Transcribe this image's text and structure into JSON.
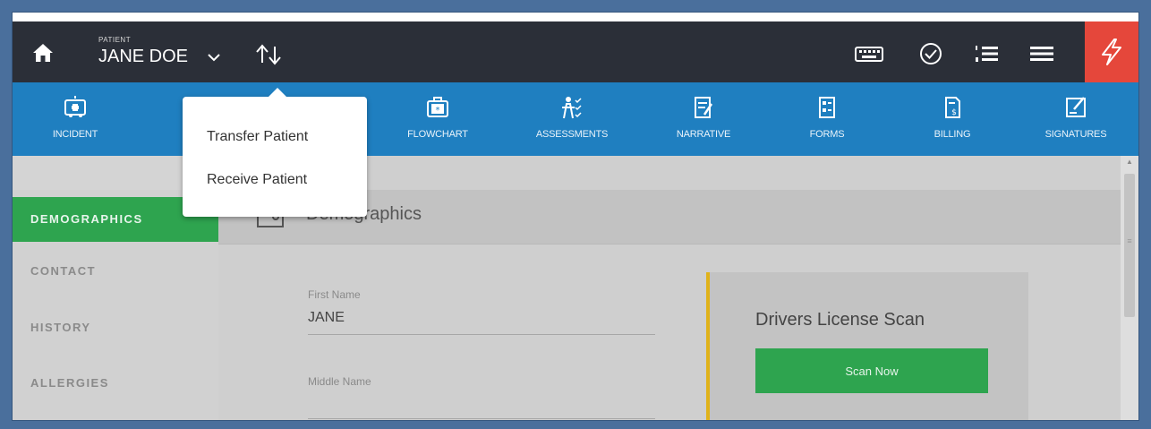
{
  "header": {
    "patient_label": "PATIENT",
    "patient_name": "JANE DOE"
  },
  "icons": {
    "home": "home-icon",
    "chevron": "chevron-down-icon",
    "transfer": "transfer-arrows-icon",
    "keyboard": "keyboard-icon",
    "check": "check-circle-icon",
    "list": "numbered-list-icon",
    "menu": "hamburger-menu-icon",
    "alert": "lightning-icon"
  },
  "colors": {
    "topbar": "#2b2f38",
    "navbar": "#1f7fc0",
    "active_green": "#2ea44f",
    "alert_red": "#e5473b",
    "accent_yellow": "#e0b21a"
  },
  "nav": {
    "items": [
      {
        "label": "INCIDENT",
        "icon": "ambulance-icon"
      },
      {
        "label": "",
        "icon": "patient-icon"
      },
      {
        "label": "",
        "icon": "vitals-icon"
      },
      {
        "label": "FLOWCHART",
        "icon": "medkit-icon"
      },
      {
        "label": "ASSESSMENTS",
        "icon": "assessment-icon"
      },
      {
        "label": "NARRATIVE",
        "icon": "narrative-icon"
      },
      {
        "label": "FORMS",
        "icon": "forms-icon"
      },
      {
        "label": "BILLING",
        "icon": "billing-icon"
      },
      {
        "label": "SIGNATURES",
        "icon": "signature-icon"
      }
    ]
  },
  "popup": {
    "transfer_label": "Transfer Patient",
    "receive_label": "Receive Patient"
  },
  "sidebar": {
    "items": [
      {
        "label": "DEMOGRAPHICS",
        "active": true
      },
      {
        "label": "CONTACT",
        "active": false
      },
      {
        "label": "HISTORY",
        "active": false
      },
      {
        "label": "ALLERGIES",
        "active": false
      }
    ]
  },
  "section": {
    "title": "Demographics"
  },
  "form": {
    "first_name_label": "First Name",
    "first_name_value": "JANE",
    "middle_name_label": "Middle Name",
    "middle_name_value": ""
  },
  "license_card": {
    "title": "Drivers License Scan",
    "button_label": "Scan Now"
  }
}
